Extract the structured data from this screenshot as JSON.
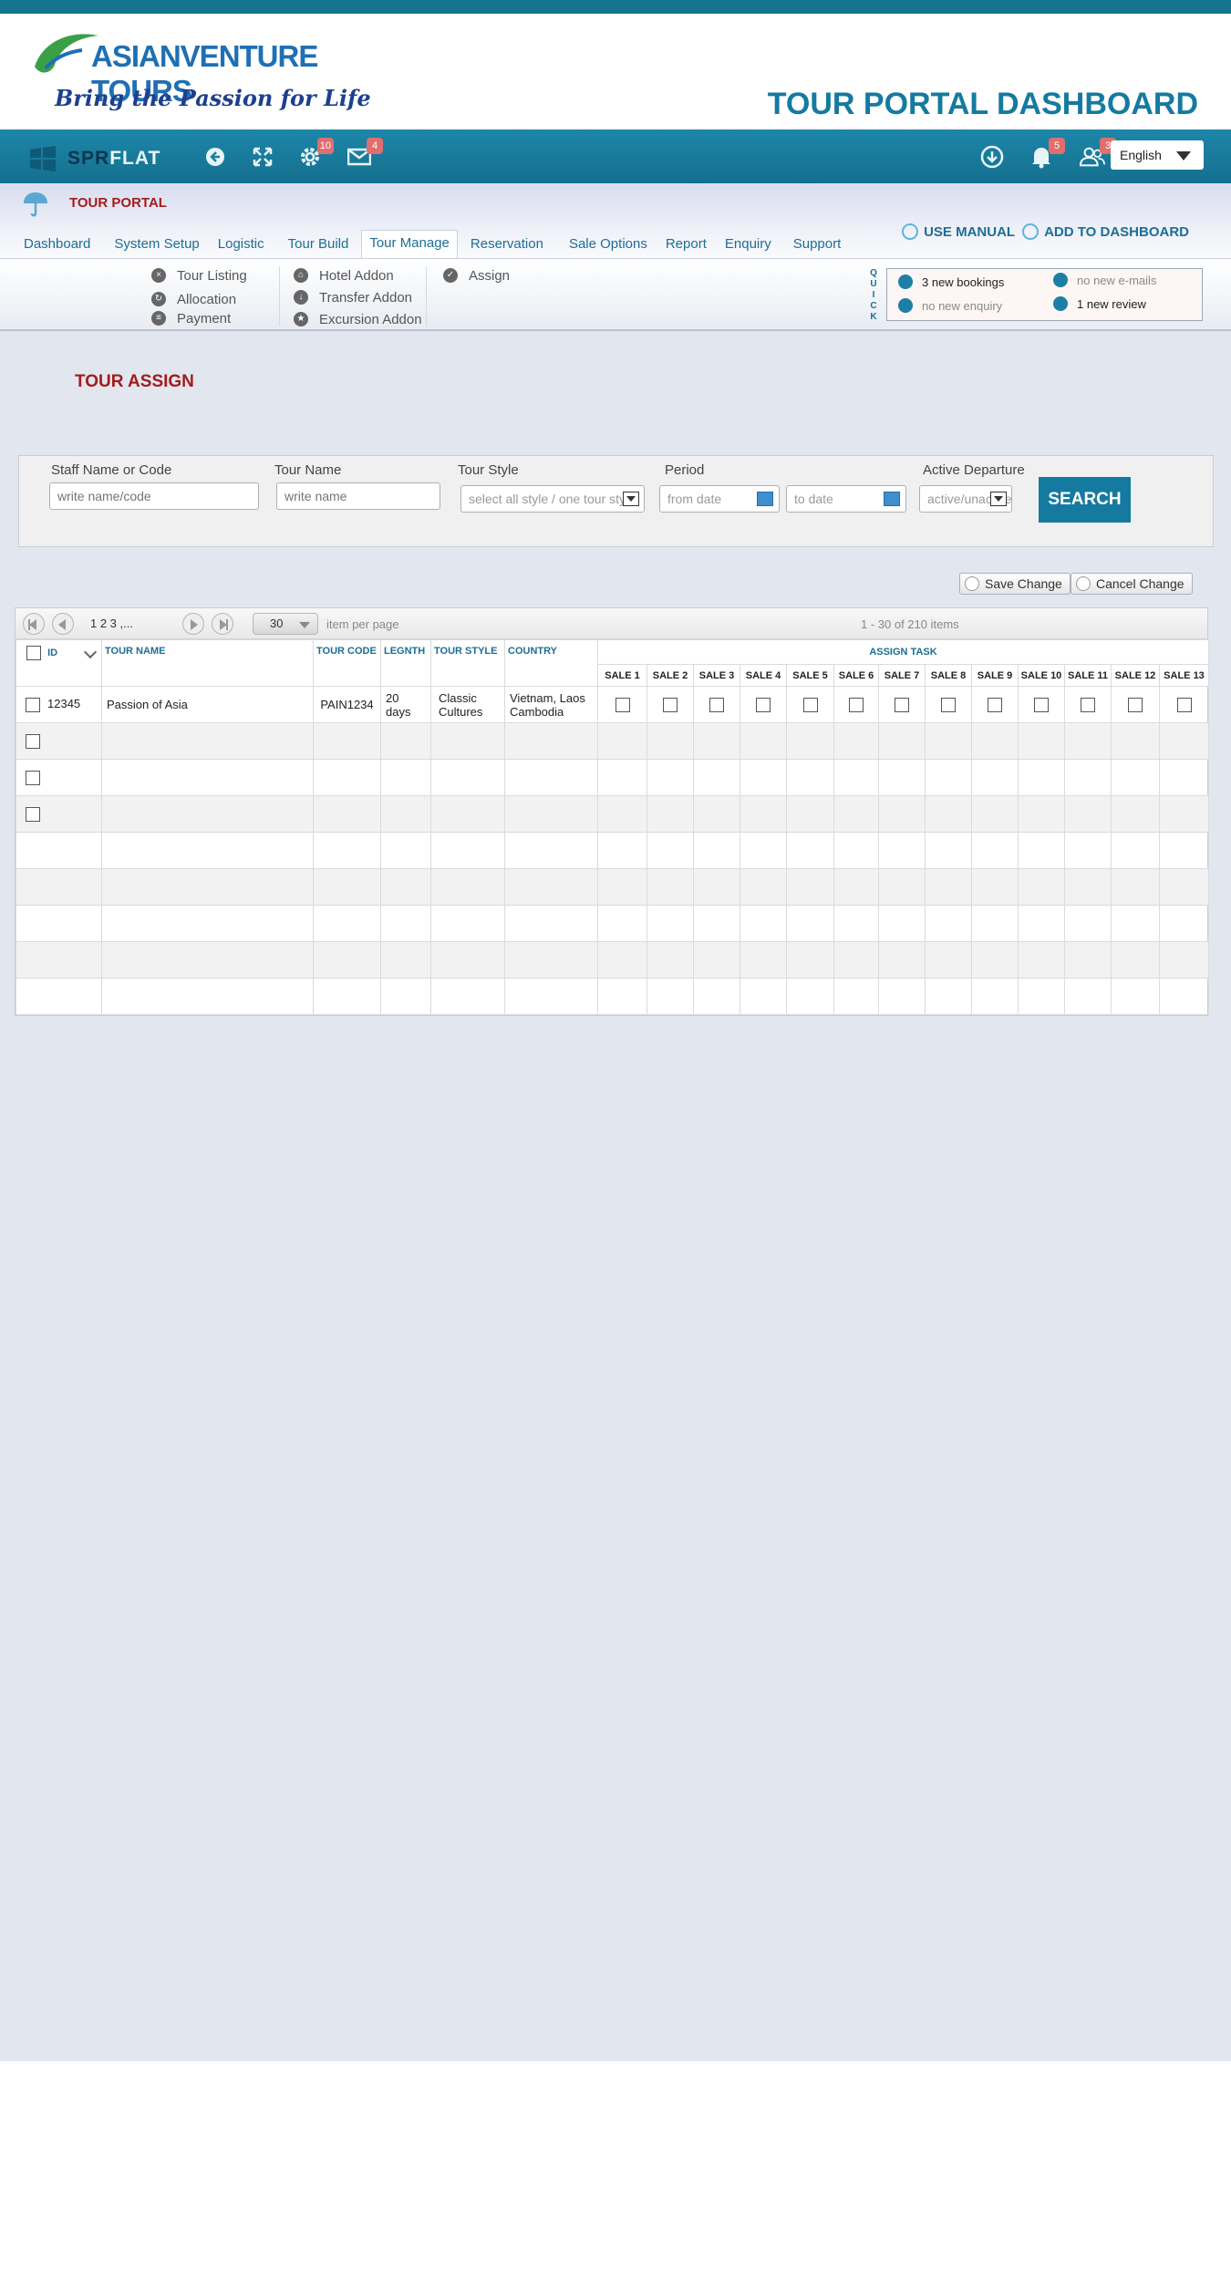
{
  "header": {
    "logo_name": "ASIANVENTURE TOURS",
    "logo_tagline": "Bring the Passion for Life",
    "dashboard_title": "TOUR PORTAL DASHBOARD"
  },
  "toolbar": {
    "brand_dark": "SPR",
    "brand_light": "FLAT",
    "settings_badge": "10",
    "mail_badge": "4",
    "notifications_badge": "5",
    "users_badge": "3",
    "language": "English"
  },
  "portal": {
    "title": "TOUR PORTAL",
    "nav": [
      "Dashboard",
      "System Setup",
      "Logistic",
      "Tour Build",
      "Tour Manage",
      "Reservation",
      "Sale Options",
      "Report",
      "Enquiry",
      "Support"
    ],
    "active_nav": "Tour Manage",
    "use_manual": "USE MANUAL",
    "add_to_dashboard": "ADD TO  DASHBOARD"
  },
  "submenu": {
    "col1": [
      "Tour Listing",
      "Allocation",
      "Payment"
    ],
    "col2": [
      "Hotel Addon",
      "Transfer Addon",
      "Excursion Addon"
    ],
    "col3": [
      "Assign"
    ]
  },
  "quick": {
    "label": [
      "Q",
      "U",
      "I",
      "C",
      "K"
    ],
    "bookings": "3 new bookings",
    "emails": "no new e-mails",
    "enquiry": "no new enquiry",
    "review": "1 new review"
  },
  "page": {
    "title": "TOUR ASSIGN"
  },
  "filter": {
    "staff_label": "Staff Name or Code",
    "staff_placeholder": "write name/code",
    "tour_label": "Tour Name",
    "tour_placeholder": "write name",
    "style_label": "Tour  Style",
    "style_value": "select all style / one tour style",
    "period_label": "Period",
    "from_placeholder": "from date",
    "to_placeholder": "to date",
    "departure_label": "Active  Departure",
    "departure_value": "active/unactive",
    "search_label": "SEARCH"
  },
  "actions": {
    "save": "Save Change",
    "cancel": "Cancel Change"
  },
  "pager": {
    "pages": "1  2  3 ,...",
    "page_size": "30",
    "per_page": "item per page",
    "info": "1 - 30  of 210 items"
  },
  "table": {
    "columns": {
      "id": "ID",
      "name": "TOUR  NAME",
      "code": "TOUR CODE",
      "length": "LEGNTH",
      "style": "TOUR  STYLE",
      "country": "COUNTRY",
      "assign": "ASSIGN TASK"
    },
    "sales": [
      "SALE 1",
      "SALE 2",
      "SALE 3",
      "SALE 4",
      "SALE 5",
      "SALE 6",
      "SALE 7",
      "SALE 8",
      "SALE 9",
      "SALE 10",
      "SALE 11",
      "SALE 12",
      "SALE 13"
    ],
    "rows": [
      {
        "id": "12345",
        "name": "Passion of Asia",
        "code": "PAIN1234",
        "length": "20 days",
        "style": "Classic Cultures",
        "country": "Vietnam, Laos Cambodia"
      }
    ]
  }
}
